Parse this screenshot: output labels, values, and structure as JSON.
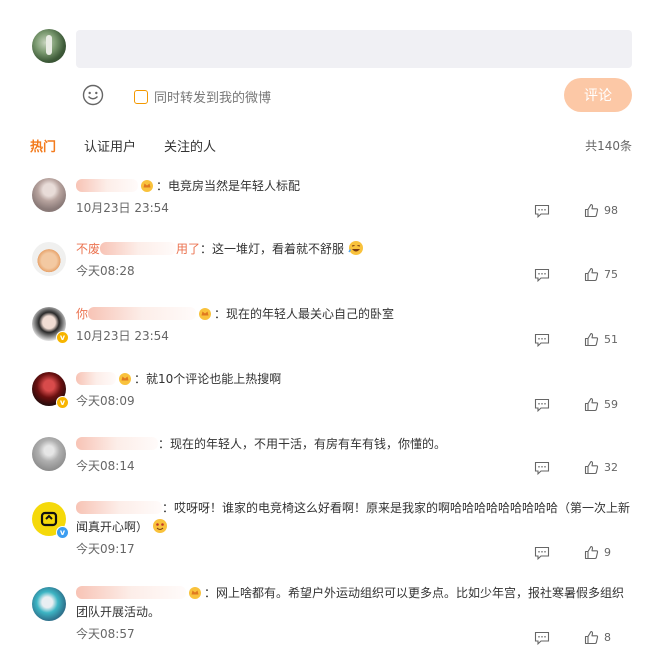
{
  "composer": {
    "placeholder": "",
    "repost_label": "同时转发到我的微博",
    "submit_label": "评论"
  },
  "tabs": [
    "热门",
    "认证用户",
    "关注的人"
  ],
  "total": "共140条",
  "colors": {
    "accent": "#f37b1d",
    "username": "#eb7350",
    "submit_bg": "#fcc8a6"
  },
  "comments": [
    {
      "user_prefix": "",
      "user_suffix": "",
      "text": "：电竞房当然是年轻人标配",
      "time": "10月23日 23:54",
      "likes": "98",
      "icon": "crown-icon"
    },
    {
      "user_prefix": "不废",
      "user_suffix": "用了",
      "text": "：这一堆灯，看着就不舒服",
      "time": "今天08:28",
      "likes": "75",
      "icon": "none"
    },
    {
      "user_prefix": "你",
      "user_suffix": "",
      "text": "：现在的年轻人最关心自己的卧室",
      "time": "10月23日 23:54",
      "likes": "51",
      "icon": "crown-icon"
    },
    {
      "user_prefix": "",
      "user_suffix": "",
      "text": "：就10个评论也能上热搜啊",
      "time": "今天08:09",
      "likes": "59",
      "icon": "crown-icon"
    },
    {
      "user_prefix": "",
      "user_suffix": "",
      "text": "：现在的年轻人，不用干活，有房有车有钱，你懂的。",
      "time": "今天08:14",
      "likes": "32",
      "icon": "none"
    },
    {
      "user_prefix": "",
      "user_suffix": "",
      "text": "：哎呀呀！谁家的电竞椅这么好看啊！原来是我家的啊哈哈哈哈哈哈哈哈哈（第一次上新闻真开心啊）",
      "time": "今天09:17",
      "likes": "9",
      "icon": "none"
    },
    {
      "user_prefix": "",
      "user_suffix": "",
      "text": "：网上啥都有。希望户外运动组织可以更多点。比如少年宫，报社寒暑假多组织团队开展活动。",
      "time": "今天08:57",
      "likes": "8",
      "icon": "crown-icon"
    }
  ]
}
